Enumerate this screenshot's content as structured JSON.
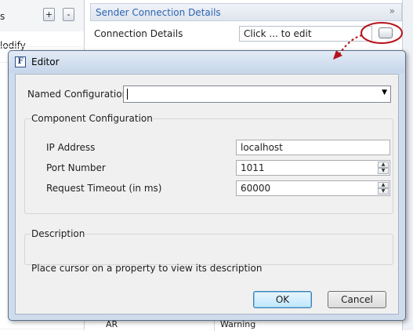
{
  "background": {
    "left_header_text": "s",
    "left_list_text": "lodify",
    "add_button": "+",
    "remove_button": "-",
    "section_title": "Sender Connection Details",
    "section_toggle": "»",
    "property_label": "Connection Details",
    "property_value": "Click ... to edit",
    "bottom_row": {
      "col1": "AR",
      "col2": "Warning"
    }
  },
  "editor": {
    "title": "Editor",
    "app_icon_letter": "F",
    "named_configuration": {
      "label": "Named Configuration",
      "value": ""
    },
    "component_configuration": {
      "title": "Component Configuration",
      "fields": [
        {
          "label": "IP Address",
          "value": "localhost"
        },
        {
          "label": "Port Number",
          "value": "1011"
        },
        {
          "label": "Request Timeout (in ms)",
          "value": "60000"
        }
      ]
    },
    "description": {
      "title": "Description",
      "text": "Place cursor on a property to view its description"
    },
    "ok_label": "OK",
    "cancel_label": "Cancel"
  },
  "colors": {
    "annotation": "#b5121b",
    "section_title": "#2c64b0",
    "dialog_frame": "#cfdcec"
  },
  "icons": {
    "dropdown": "chevron-down-icon",
    "spinner_up": "arrow-up-icon",
    "spinner_down": "arrow-down-icon"
  }
}
